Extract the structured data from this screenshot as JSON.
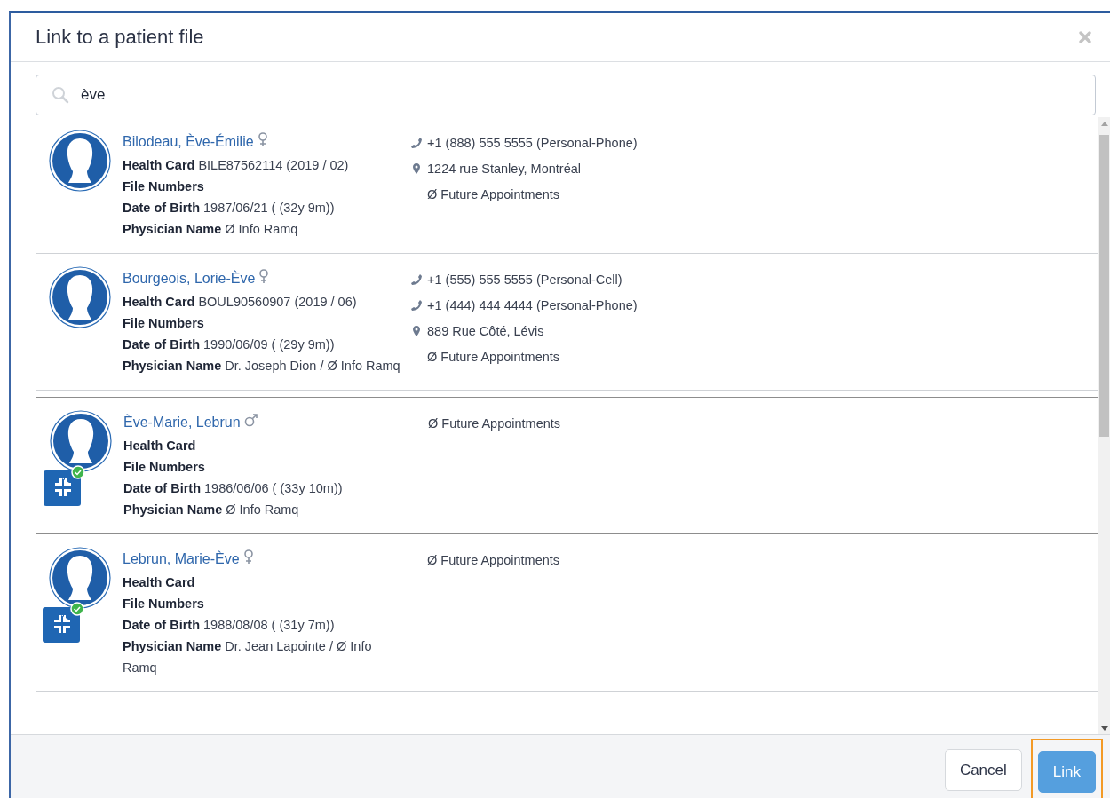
{
  "dialog": {
    "title": "Link to a patient file"
  },
  "search": {
    "value": "ève"
  },
  "patients": [
    {
      "name": "Bilodeau, Ève-Émilie",
      "female": true,
      "selected": false,
      "app_badge": false,
      "details": [
        {
          "label": "Health Card",
          "value": "BILE87562114 (2019 / 02)"
        },
        {
          "label": "File Numbers"
        },
        {
          "label": "Date of Birth",
          "value": "1987/06/21 ( (32y 9m))"
        },
        {
          "label": "Physician Name",
          "value": "Ø Info Ramq"
        }
      ],
      "contacts": [
        {
          "kind": "phone",
          "text": "+1 (888) 555 5555 (Personal-Phone)"
        },
        {
          "kind": "address",
          "text": "1224 rue Stanley, Montréal"
        },
        {
          "kind": "note",
          "text": "Ø Future Appointments"
        }
      ]
    },
    {
      "name": "Bourgeois, Lorie-Ève",
      "female": true,
      "selected": false,
      "app_badge": false,
      "details": [
        {
          "label": "Health Card",
          "value": "BOUL90560907 (2019 / 06)"
        },
        {
          "label": "File Numbers"
        },
        {
          "label": "Date of Birth",
          "value": "1990/06/09 ( (29y 9m))"
        },
        {
          "label": "Physician Name",
          "value": "Dr. Joseph Dion / Ø Info Ramq"
        }
      ],
      "contacts": [
        {
          "kind": "phone",
          "text": "+1 (555) 555 5555 (Personal-Cell)"
        },
        {
          "kind": "phone",
          "text": "+1 (444) 444 4444 (Personal-Phone)"
        },
        {
          "kind": "address",
          "text": "889 Rue Côté, Lévis"
        },
        {
          "kind": "note",
          "text": "Ø Future Appointments"
        }
      ]
    },
    {
      "name": "Ève-Marie, Lebrun",
      "female": false,
      "selected": true,
      "app_badge": true,
      "details": [
        {
          "label": "Health Card"
        },
        {
          "label": "File Numbers"
        },
        {
          "label": "Date of Birth",
          "value": "1986/06/06 ( (33y 10m))"
        },
        {
          "label": "Physician Name",
          "value": "Ø Info Ramq"
        }
      ],
      "contacts": [
        {
          "kind": "note",
          "text": "Ø Future Appointments"
        }
      ]
    },
    {
      "name": "Lebrun, Marie-Ève",
      "female": true,
      "selected": false,
      "app_badge": true,
      "details": [
        {
          "label": "Health Card"
        },
        {
          "label": "File Numbers"
        },
        {
          "label": "Date of Birth",
          "value": "1988/08/08 ( (31y 7m))"
        },
        {
          "label": "Physician Name",
          "value": "Dr. Jean Lapointe / Ø Info Ramq"
        }
      ],
      "contacts": [
        {
          "kind": "note",
          "text": "Ø Future Appointments"
        }
      ]
    }
  ],
  "buttons": [
    {
      "label": "Cancel",
      "kind": "secondary",
      "highlighted": false
    },
    {
      "label": "Link",
      "kind": "primary",
      "highlighted": true
    }
  ]
}
